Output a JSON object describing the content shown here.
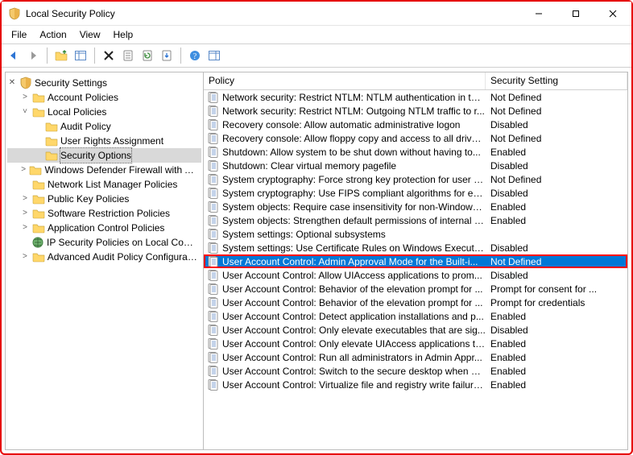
{
  "window": {
    "title": "Local Security Policy"
  },
  "menu": [
    "File",
    "Action",
    "View",
    "Help"
  ],
  "toolbar_icons": [
    "back-icon",
    "forward-icon",
    "up-icon",
    "show-hide-tree-icon",
    "delete-icon",
    "properties-icon",
    "refresh-icon",
    "export-list-icon",
    "help-icon",
    "show-hide-action-pane-icon"
  ],
  "tree_root": "Security Settings",
  "tree": [
    {
      "label": "Account Policies",
      "indent": 1,
      "expandable": true,
      "expanded": false
    },
    {
      "label": "Local Policies",
      "indent": 1,
      "expandable": true,
      "expanded": true
    },
    {
      "label": "Audit Policy",
      "indent": 2,
      "expandable": false
    },
    {
      "label": "User Rights Assignment",
      "indent": 2,
      "expandable": false
    },
    {
      "label": "Security Options",
      "indent": 2,
      "expandable": false,
      "selected": true
    },
    {
      "label": "Windows Defender Firewall with Advanced Security",
      "indent": 1,
      "expandable": true,
      "expanded": false
    },
    {
      "label": "Network List Manager Policies",
      "indent": 1,
      "expandable": false,
      "folderOnly": true
    },
    {
      "label": "Public Key Policies",
      "indent": 1,
      "expandable": true,
      "expanded": false
    },
    {
      "label": "Software Restriction Policies",
      "indent": 1,
      "expandable": true,
      "expanded": false
    },
    {
      "label": "Application Control Policies",
      "indent": 1,
      "expandable": true,
      "expanded": false
    },
    {
      "label": "IP Security Policies on Local Computer",
      "indent": 1,
      "expandable": false,
      "ipsec": true
    },
    {
      "label": "Advanced Audit Policy Configuration",
      "indent": 1,
      "expandable": true,
      "expanded": false
    }
  ],
  "columns": {
    "policy": "Policy",
    "setting": "Security Setting"
  },
  "policies": [
    {
      "name": "Network security: Restrict NTLM: NTLM authentication in thi...",
      "setting": "Not Defined"
    },
    {
      "name": "Network security: Restrict NTLM: Outgoing NTLM traffic to r...",
      "setting": "Not Defined"
    },
    {
      "name": "Recovery console: Allow automatic administrative logon",
      "setting": "Disabled"
    },
    {
      "name": "Recovery console: Allow floppy copy and access to all drives...",
      "setting": "Not Defined"
    },
    {
      "name": "Shutdown: Allow system to be shut down without having to...",
      "setting": "Enabled"
    },
    {
      "name": "Shutdown: Clear virtual memory pagefile",
      "setting": "Disabled"
    },
    {
      "name": "System cryptography: Force strong key protection for user k...",
      "setting": "Not Defined"
    },
    {
      "name": "System cryptography: Use FIPS compliant algorithms for en...",
      "setting": "Disabled"
    },
    {
      "name": "System objects: Require case insensitivity for non-Windows ...",
      "setting": "Enabled"
    },
    {
      "name": "System objects: Strengthen default permissions of internal s...",
      "setting": "Enabled"
    },
    {
      "name": "System settings: Optional subsystems",
      "setting": ""
    },
    {
      "name": "System settings: Use Certificate Rules on Windows Executab...",
      "setting": "Disabled"
    },
    {
      "name": "User Account Control: Admin Approval Mode for the Built-i...",
      "setting": "Not Defined",
      "selected": true
    },
    {
      "name": "User Account Control: Allow UIAccess applications to prom...",
      "setting": "Disabled"
    },
    {
      "name": "User Account Control: Behavior of the elevation prompt for ...",
      "setting": "Prompt for consent for ..."
    },
    {
      "name": "User Account Control: Behavior of the elevation prompt for ...",
      "setting": "Prompt for credentials"
    },
    {
      "name": "User Account Control: Detect application installations and p...",
      "setting": "Enabled"
    },
    {
      "name": "User Account Control: Only elevate executables that are sig...",
      "setting": "Disabled"
    },
    {
      "name": "User Account Control: Only elevate UIAccess applications th...",
      "setting": "Enabled"
    },
    {
      "name": "User Account Control: Run all administrators in Admin Appr...",
      "setting": "Enabled"
    },
    {
      "name": "User Account Control: Switch to the secure desktop when pr...",
      "setting": "Enabled"
    },
    {
      "name": "User Account Control: Virtualize file and registry write failure...",
      "setting": "Enabled"
    }
  ]
}
